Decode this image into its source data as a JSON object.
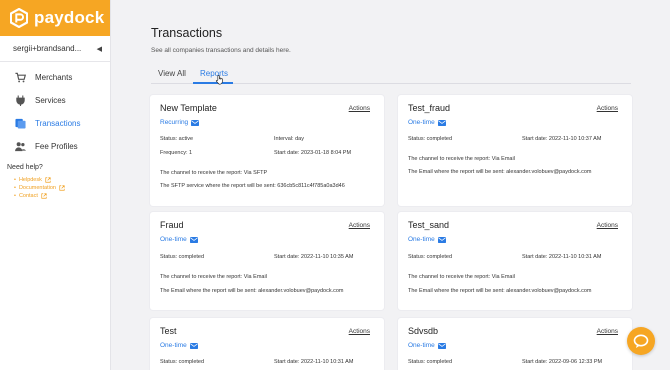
{
  "brand": {
    "name": "paydock",
    "color": "#f6a623"
  },
  "account": {
    "name": "sergii+brandsand..."
  },
  "nav": {
    "merchants": "Merchants",
    "services": "Services",
    "transactions": "Transactions",
    "fee_profiles": "Fee Profiles"
  },
  "help": {
    "title": "Need help?",
    "helpdesk": "Helpdesk",
    "documentation": "Documentation",
    "contact": "Contact"
  },
  "page": {
    "title": "Transactions",
    "subtitle": "See all companies transactions and details here."
  },
  "tabs": {
    "view_all": "View All",
    "reports": "Reports",
    "active": "Reports"
  },
  "cards": [
    {
      "title": "New Template",
      "actions": "Actions",
      "type": "Recurring",
      "status": "Status: active",
      "interval": "Interval: day",
      "frequency": "Frequency: 1",
      "start_date": "Start date: 2023-01-18 8:04 PM",
      "channel": "The channel to receive the report: Via SFTP",
      "destination": "The SFTP service where the report will be sent: 636cb5c811c4f785a0a3d46"
    },
    {
      "title": "Test_fraud",
      "actions": "Actions",
      "type": "One-time",
      "status": "Status: completed",
      "start_date": "Start date: 2022-11-10 10:37 AM",
      "channel": "The channel to receive the report: Via Email",
      "destination": "The Email where the report will be sent: alexander.volobuev@paydock.com"
    },
    {
      "title": "Fraud",
      "actions": "Actions",
      "type": "One-time",
      "status": "Status: completed",
      "start_date": "Start date: 2022-11-10 10:35 AM",
      "channel": "The channel to receive the report: Via Email",
      "destination": "The Email where the report will be sent: alexander.volobuev@paydock.com"
    },
    {
      "title": "Test_sand",
      "actions": "Actions",
      "type": "One-time",
      "status": "Status: completed",
      "start_date": "Start date: 2022-11-10 10:31 AM",
      "channel": "The channel to receive the report: Via Email",
      "destination": "The Email where the report will be sent: alexander.volobuev@paydock.com"
    },
    {
      "title": "Test",
      "actions": "Actions",
      "type": "One-time",
      "status": "Status: completed",
      "start_date": "Start date: 2022-11-10 10:31 AM"
    },
    {
      "title": "Sdvsdb",
      "actions": "Actions",
      "type": "One-time",
      "status": "Status: completed",
      "start_date": "Start date: 2022-09-06 12:33 PM"
    }
  ]
}
